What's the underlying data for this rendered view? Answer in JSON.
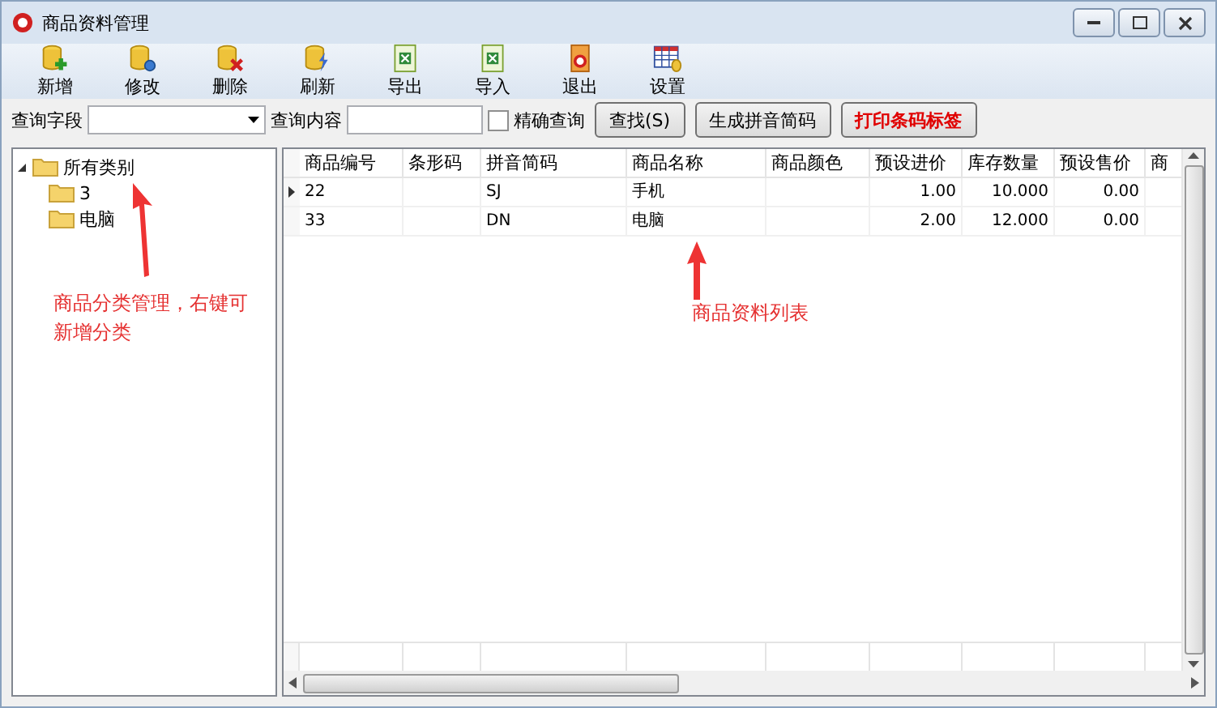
{
  "window": {
    "title": "商品资料管理"
  },
  "toolbar": [
    {
      "label": "新增",
      "kind": "add"
    },
    {
      "label": "修改",
      "kind": "edit"
    },
    {
      "label": "删除",
      "kind": "delete"
    },
    {
      "label": "刷新",
      "kind": "refresh"
    },
    {
      "label": "导出",
      "kind": "export"
    },
    {
      "label": "导入",
      "kind": "import"
    },
    {
      "label": "退出",
      "kind": "exit"
    },
    {
      "label": "设置",
      "kind": "settings"
    }
  ],
  "search": {
    "field_label": "查询字段",
    "content_label": "查询内容",
    "exact_match": {
      "label": "精确查询",
      "checked": false
    },
    "buttons": [
      {
        "label": "查找(S)",
        "kind": "normal"
      },
      {
        "label": "生成拼音简码",
        "kind": "normal"
      },
      {
        "label": "打印条码标签",
        "kind": "alert"
      }
    ]
  },
  "tree": {
    "label": "所有类别",
    "expanded": true,
    "children": [
      {
        "label": "3"
      },
      {
        "label": "电脑"
      }
    ]
  },
  "table": {
    "columns": [
      "商品编号",
      "条形码",
      "拼音简码",
      "商品名称",
      "商品颜色",
      "预设进价",
      "库存数量",
      "预设售价",
      "商"
    ],
    "rows": [
      {
        "selected": true,
        "cells": [
          "22",
          "",
          "SJ",
          "手机",
          "",
          "1.00",
          "10.000",
          "0.00"
        ]
      },
      {
        "selected": false,
        "cells": [
          "33",
          "",
          "DN",
          "电脑",
          "",
          "2.00",
          "12.000",
          "0.00"
        ]
      }
    ]
  },
  "annotations": [
    {
      "text": "商品分类管理，右键可新增分类"
    },
    {
      "text": "商品资料列表"
    }
  ]
}
